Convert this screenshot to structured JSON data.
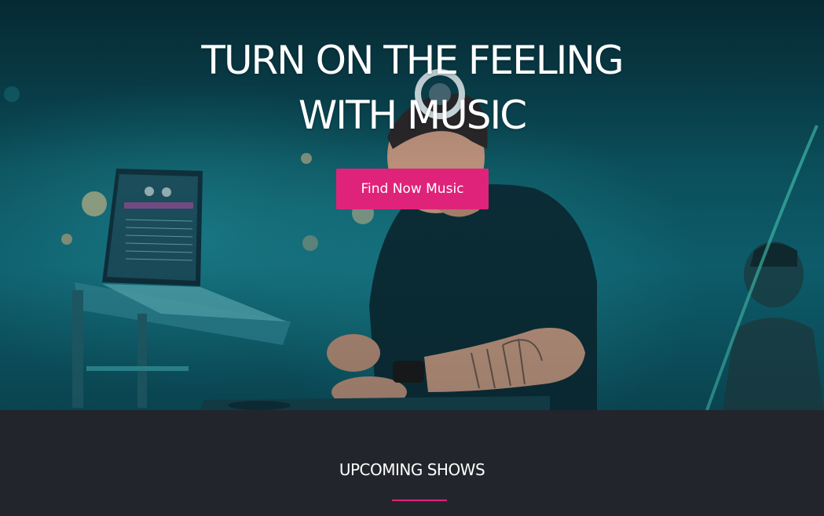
{
  "hero": {
    "title_line1": "TURN ON THE FEELING",
    "title_line2": "WITH MUSIC",
    "cta_label": "Find Now Music",
    "image_description_icon": "dj-performer-photo"
  },
  "shows": {
    "title": "UPCOMING SHOWS"
  },
  "colors": {
    "accent": "#e0237a",
    "section_bg": "#23252c",
    "hero_tint": "#0e6170"
  }
}
